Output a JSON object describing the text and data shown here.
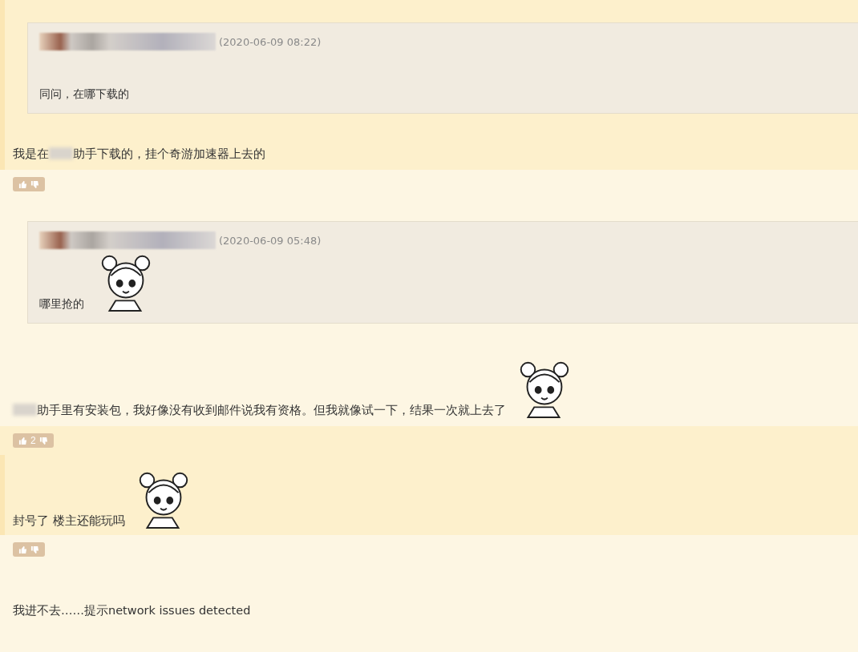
{
  "blocks": [
    {
      "kind": "post",
      "highlighted": true,
      "quote": {
        "date": "(2020-06-09 08:22)",
        "text": "同问，在哪下载的",
        "sticker": false
      },
      "body": [
        {
          "kind": "text",
          "text": "我是在"
        },
        {
          "kind": "blur"
        },
        {
          "kind": "text",
          "text": "助手下载的，挂个奇游加速器上去的"
        }
      ],
      "sticker": false
    },
    {
      "kind": "vote",
      "highlighted": false
    },
    {
      "kind": "post",
      "highlighted": false,
      "quote": {
        "date": "(2020-06-09 05:48)",
        "text": "哪里抢的",
        "sticker": true
      },
      "body": [
        {
          "kind": "blur"
        },
        {
          "kind": "text",
          "text": "助手里有安装包，我好像没有收到邮件说我有资格。但我就像试一下，结果一次就上去了"
        }
      ],
      "sticker": true
    },
    {
      "kind": "vote",
      "highlighted": true,
      "count": "2"
    },
    {
      "kind": "post",
      "highlighted": true,
      "body": [
        {
          "kind": "text",
          "text": "封号了 楼主还能玩吗"
        }
      ],
      "sticker": true
    },
    {
      "kind": "vote",
      "highlighted": false
    },
    {
      "kind": "post",
      "highlighted": false,
      "body": [
        {
          "kind": "text",
          "text": "我进不去……提示network issues detected"
        }
      ],
      "sticker": false
    }
  ]
}
